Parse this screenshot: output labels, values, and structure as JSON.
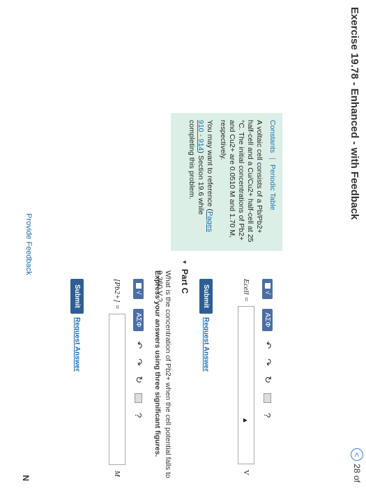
{
  "header": {
    "title": "Exercise 19.78 - Enhanced - with Feedback",
    "counter_icon": "<",
    "counter_text": "28 of"
  },
  "sidebar": {
    "links": {
      "constants": "Constants",
      "separator": "|",
      "periodic": "Periodic Table"
    },
    "paragraph1": "A voltaic cell consists of a Pb/Pb2+ half-cell and a Cu/Cu2+ half-cell at 25 °C. The initial concentrations of Pb2+ and Cu2+ are 0.0510 M and 1.70 M, respectively.",
    "paragraph2_prefix": "You may want to reference (",
    "pages_link": "Pages 910 - 914",
    "paragraph2_suffix": ") Section 19.6 while completing this problem."
  },
  "toolbar_labels": {
    "sqrt": "√",
    "greek": "ΑΣΦ",
    "help": "?"
  },
  "part_b": {
    "label": "Ecell =",
    "unit": "V",
    "submit": "Submit",
    "request": "Request Answer"
  },
  "part_c": {
    "title": "Part C",
    "question": "What is the concentration of Pb2+ when the cell potential falls to 0.360 V ?",
    "instruction": "Express your answers using three significant figures.",
    "label": "[Pb2+] =",
    "unit": "M",
    "submit": "Submit",
    "request": "Request Answer"
  },
  "footer": {
    "feedback": "Provide Feedback",
    "next": "N"
  }
}
